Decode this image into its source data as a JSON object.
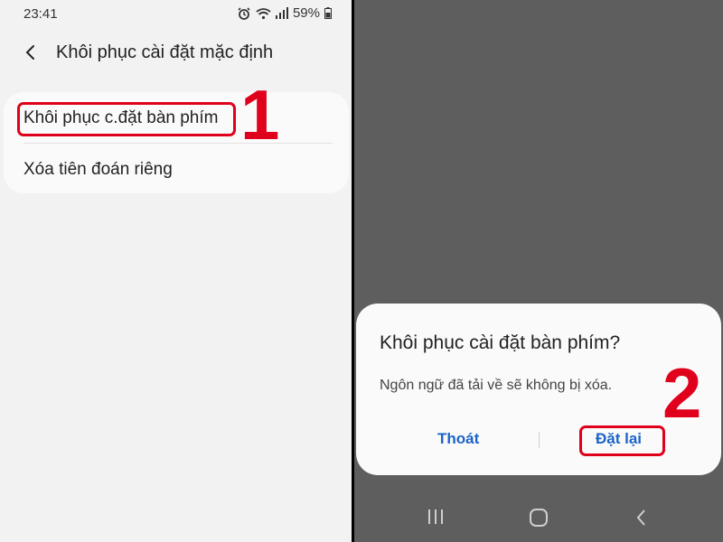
{
  "status": {
    "time": "23:41",
    "battery": "59%"
  },
  "settings": {
    "title": "Khôi phục cài đặt mặc định",
    "items": [
      {
        "label": "Khôi phục c.đặt bàn phím"
      },
      {
        "label": "Xóa tiên đoán riêng"
      }
    ]
  },
  "dialog": {
    "title": "Khôi phục cài đặt bàn phím?",
    "message": "Ngôn ngữ đã tải về sẽ không bị xóa.",
    "cancel_label": "Thoát",
    "confirm_label": "Đặt lại"
  },
  "steps": {
    "one": "1",
    "two": "2"
  },
  "colors": {
    "highlight": "#e0001b",
    "accent": "#1c64c8"
  }
}
